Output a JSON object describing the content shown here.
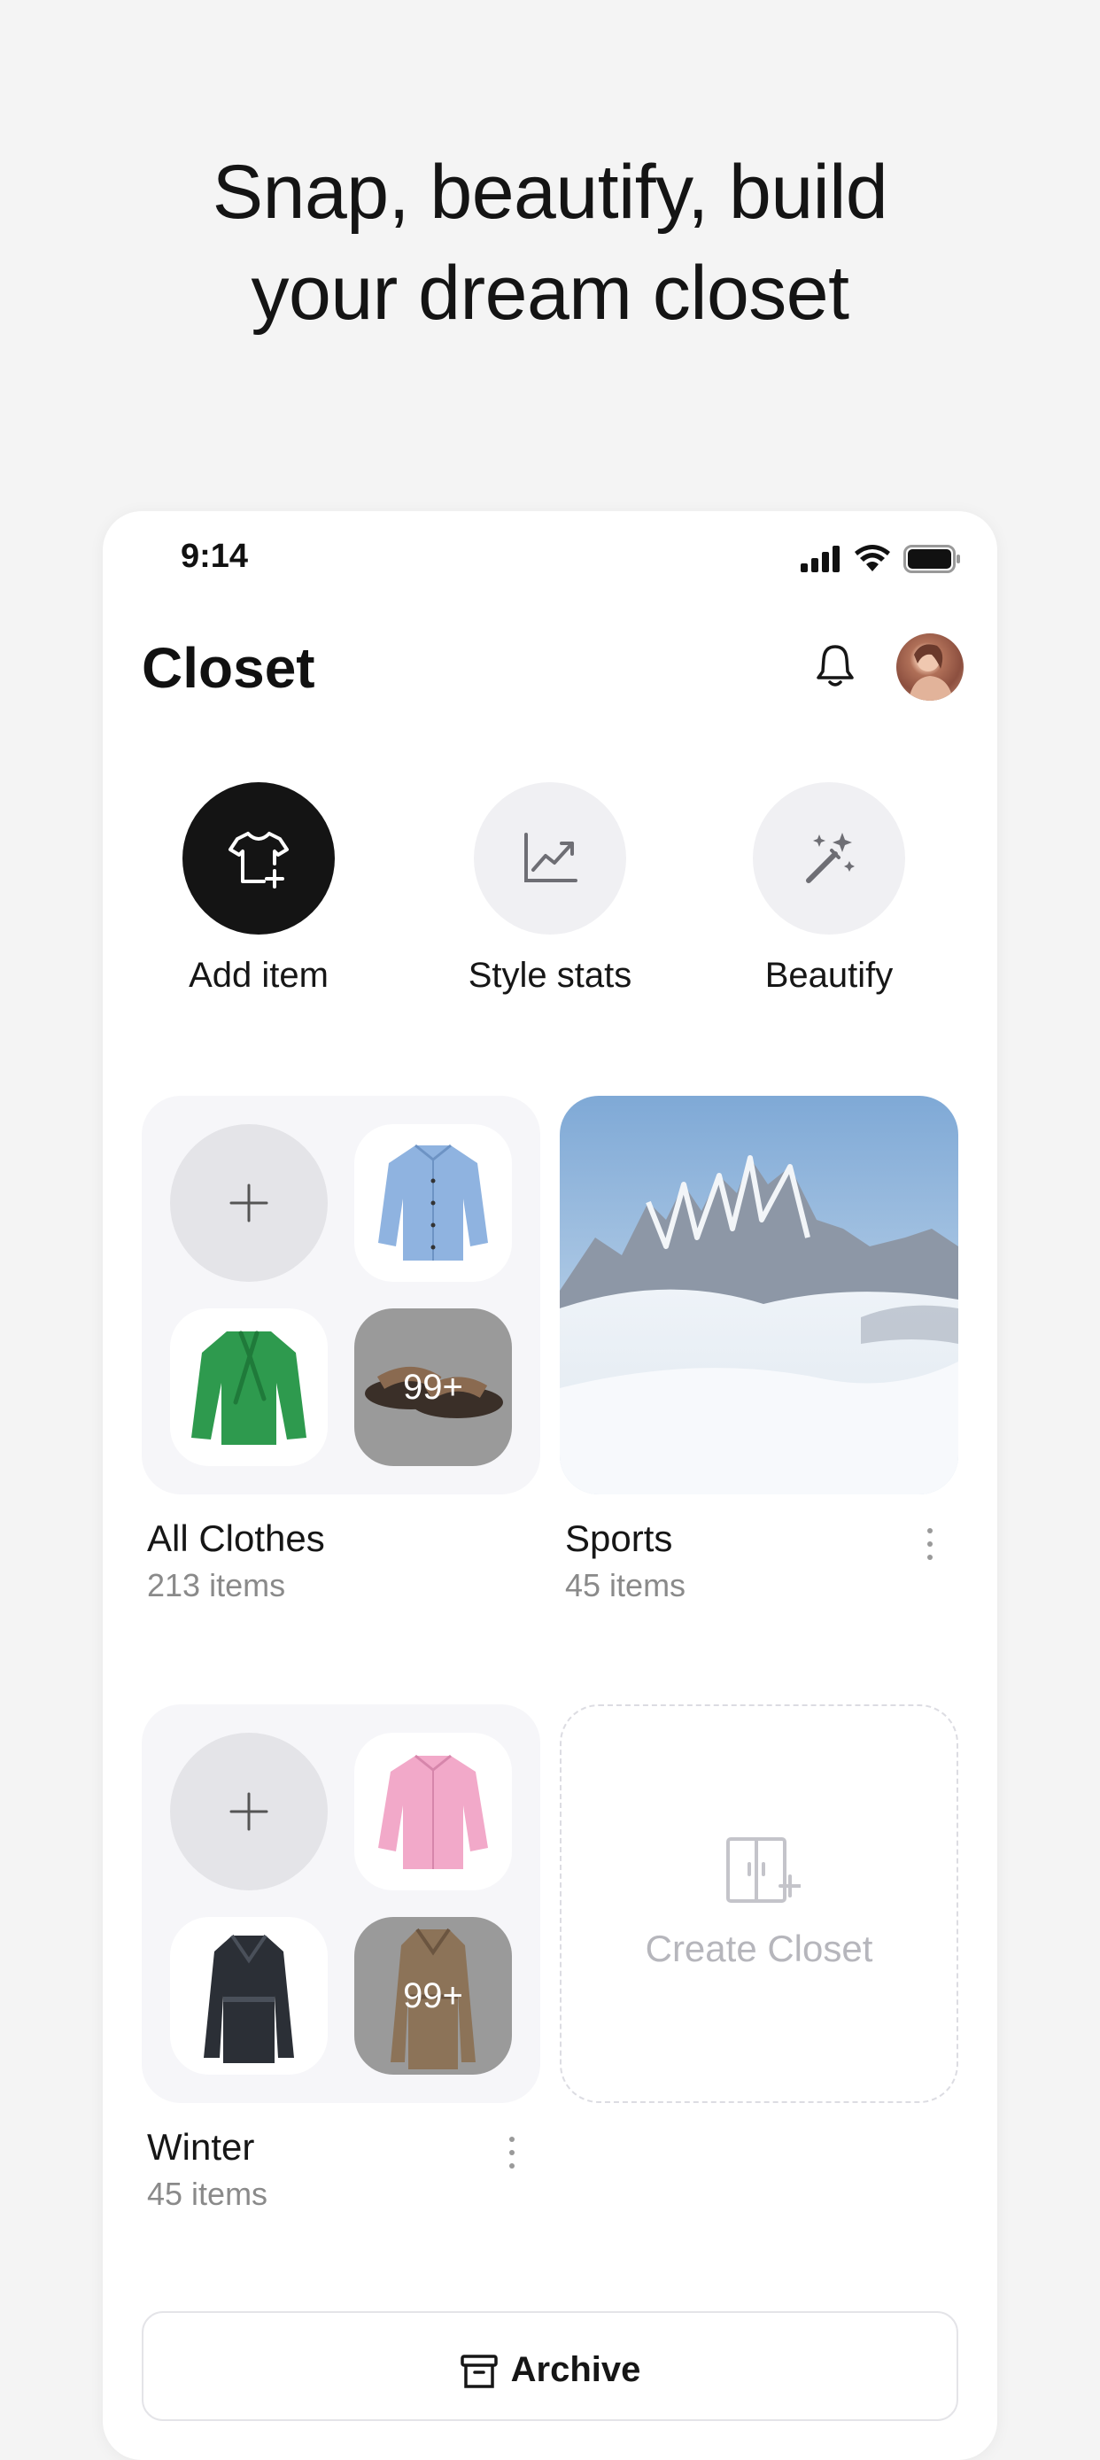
{
  "headline": {
    "line1": "Snap, beautify, build",
    "line2": "your dream closet"
  },
  "status_bar": {
    "time": "9:14"
  },
  "header": {
    "title": "Closet"
  },
  "quick_actions": [
    {
      "label": "Add item",
      "icon": "tshirt-plus-icon"
    },
    {
      "label": "Style stats",
      "icon": "chart-trend-icon"
    },
    {
      "label": "Beautify",
      "icon": "magic-wand-icon"
    }
  ],
  "closets": [
    {
      "name": "All Clothes",
      "count": "213 items",
      "more_badge": "99+"
    },
    {
      "name": "Sports",
      "count": "45 items"
    },
    {
      "name": "Winter",
      "count": "45 items",
      "more_badge": "99+"
    }
  ],
  "create_closet": {
    "label": "Create Closet"
  },
  "archive": {
    "label": "Archive"
  },
  "colors": {
    "accent_dark": "#141414",
    "muted": "#8a8a8a",
    "card_bg": "#f6f6f9"
  }
}
